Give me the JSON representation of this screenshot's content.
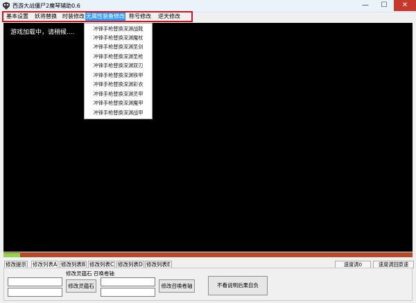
{
  "window": {
    "title": "西游大战僵尸2魔琴辅助0.6",
    "icon": "app-icon",
    "minimize_symbol": "—",
    "maximize_symbol": "☐",
    "close_symbol": "✕"
  },
  "menu": {
    "items": [
      "基本设置",
      "妖将替换",
      "时装修改",
      "无属性装备修改",
      "称号修改",
      "逆天修改"
    ],
    "active": "无属性装备修改"
  },
  "game": {
    "status_text": "游戏加载中，请稍候...."
  },
  "dropdown": {
    "items": [
      "冲锋手枪替换深渊战靴",
      "冲锋手枪替换深渊魔杖",
      "冲锋手枪替换深渊圣剑",
      "冲锋手枪替换深渊圣枪",
      "冲锋手枪替换深渊双刃",
      "冲锋手枪替换深渊铁甲",
      "冲锋手枪替换深渊彩衣",
      "冲锋手枪替换深渊灵甲",
      "冲锋手枪替换深渊魔甲",
      "冲锋手枪替换深渊战甲"
    ]
  },
  "progress": {
    "fraction": 0.04,
    "fill_color": "#8fd64a",
    "track_color": "#b84a2a"
  },
  "tabs": [
    "修改提示",
    "修改列表A",
    "修改列表B",
    "修改列表C",
    "修改列表D",
    "修改列表E"
  ],
  "active_tab": "修改列表A",
  "speed": {
    "label": "速度调0",
    "adjust_label": "速度调回原速"
  },
  "panel": {
    "group_label": "修改灵蕴石 召唤卷轴",
    "lingyun_button": "修改灵蕴石",
    "summon_button": "修改召唤卷轴",
    "help_button": "不看说明后果自负"
  }
}
